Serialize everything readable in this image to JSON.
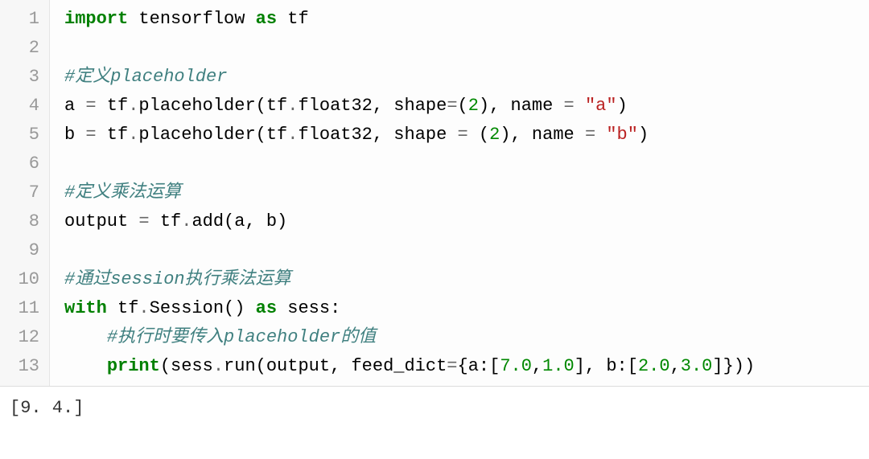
{
  "code": {
    "lines": [
      {
        "n": "1",
        "tokens": [
          {
            "t": "import",
            "c": "kw"
          },
          {
            "t": " tensorflow ",
            "c": "nm"
          },
          {
            "t": "as",
            "c": "kw"
          },
          {
            "t": " tf",
            "c": "nm"
          }
        ]
      },
      {
        "n": "2",
        "tokens": []
      },
      {
        "n": "3",
        "tokens": [
          {
            "t": "#定义placeholder",
            "c": "cm"
          }
        ]
      },
      {
        "n": "4",
        "tokens": [
          {
            "t": "a ",
            "c": "nm"
          },
          {
            "t": "=",
            "c": "op"
          },
          {
            "t": " tf",
            "c": "nm"
          },
          {
            "t": ".",
            "c": "op"
          },
          {
            "t": "placeholder(tf",
            "c": "nm"
          },
          {
            "t": ".",
            "c": "op"
          },
          {
            "t": "float32, shape",
            "c": "nm"
          },
          {
            "t": "=",
            "c": "op"
          },
          {
            "t": "(",
            "c": "paren"
          },
          {
            "t": "2",
            "c": "num"
          },
          {
            "t": "), name ",
            "c": "nm"
          },
          {
            "t": "=",
            "c": "op"
          },
          {
            "t": " ",
            "c": "nm"
          },
          {
            "t": "\"a\"",
            "c": "str"
          },
          {
            "t": ")",
            "c": "paren"
          }
        ]
      },
      {
        "n": "5",
        "tokens": [
          {
            "t": "b ",
            "c": "nm"
          },
          {
            "t": "=",
            "c": "op"
          },
          {
            "t": " tf",
            "c": "nm"
          },
          {
            "t": ".",
            "c": "op"
          },
          {
            "t": "placeholder(tf",
            "c": "nm"
          },
          {
            "t": ".",
            "c": "op"
          },
          {
            "t": "float32, shape ",
            "c": "nm"
          },
          {
            "t": "=",
            "c": "op"
          },
          {
            "t": " (",
            "c": "paren"
          },
          {
            "t": "2",
            "c": "num"
          },
          {
            "t": "), name ",
            "c": "nm"
          },
          {
            "t": "=",
            "c": "op"
          },
          {
            "t": " ",
            "c": "nm"
          },
          {
            "t": "\"b\"",
            "c": "str"
          },
          {
            "t": ")",
            "c": "paren"
          }
        ]
      },
      {
        "n": "6",
        "tokens": []
      },
      {
        "n": "7",
        "tokens": [
          {
            "t": "#定义乘法运算",
            "c": "cm"
          }
        ]
      },
      {
        "n": "8",
        "tokens": [
          {
            "t": "output ",
            "c": "nm"
          },
          {
            "t": "=",
            "c": "op"
          },
          {
            "t": " tf",
            "c": "nm"
          },
          {
            "t": ".",
            "c": "op"
          },
          {
            "t": "add(a, b)",
            "c": "nm"
          }
        ]
      },
      {
        "n": "9",
        "tokens": []
      },
      {
        "n": "10",
        "tokens": [
          {
            "t": "#通过session执行乘法运算",
            "c": "cm"
          }
        ]
      },
      {
        "n": "11",
        "tokens": [
          {
            "t": "with",
            "c": "kw"
          },
          {
            "t": " tf",
            "c": "nm"
          },
          {
            "t": ".",
            "c": "op"
          },
          {
            "t": "Session() ",
            "c": "nm"
          },
          {
            "t": "as",
            "c": "kw"
          },
          {
            "t": " sess:",
            "c": "nm"
          }
        ]
      },
      {
        "n": "12",
        "tokens": [
          {
            "t": "    ",
            "c": "nm"
          },
          {
            "t": "#执行时要传入placeholder的值",
            "c": "cm"
          }
        ]
      },
      {
        "n": "13",
        "tokens": [
          {
            "t": "    ",
            "c": "nm"
          },
          {
            "t": "print",
            "c": "kw"
          },
          {
            "t": "(sess",
            "c": "nm"
          },
          {
            "t": ".",
            "c": "op"
          },
          {
            "t": "run(output, feed_dict",
            "c": "nm"
          },
          {
            "t": "=",
            "c": "op"
          },
          {
            "t": "{a:[",
            "c": "nm"
          },
          {
            "t": "7.0",
            "c": "num"
          },
          {
            "t": ",",
            "c": "nm"
          },
          {
            "t": "1.0",
            "c": "num"
          },
          {
            "t": "], b:[",
            "c": "nm"
          },
          {
            "t": "2.0",
            "c": "num"
          },
          {
            "t": ",",
            "c": "nm"
          },
          {
            "t": "3.0",
            "c": "num"
          },
          {
            "t": "]}))",
            "c": "nm"
          }
        ]
      }
    ]
  },
  "output": {
    "text": "[9. 4.]"
  }
}
